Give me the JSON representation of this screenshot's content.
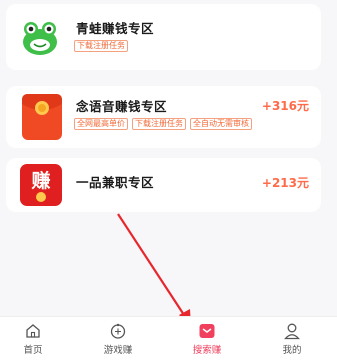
{
  "cards": [
    {
      "title": "青蛙赚钱专区",
      "tags": [
        "下载注册任务"
      ],
      "reward": "",
      "icon": "frog-icon"
    },
    {
      "title": "念语音赚钱专区",
      "tags": [
        "全网最高单价",
        "下载注册任务",
        "全自动无需审核"
      ],
      "reward": "+316元",
      "icon": "red-envelope-icon"
    },
    {
      "title": "一品兼职专区",
      "tags": [],
      "reward": "+213元",
      "icon": "earn-icon",
      "icon_text": "赚"
    }
  ],
  "tabbar": {
    "items": [
      {
        "label": "首页",
        "icon": "home-icon",
        "active": false
      },
      {
        "label": "游戏赚",
        "icon": "game-icon",
        "active": false
      },
      {
        "label": "搜索赚",
        "icon": "search-earn-icon",
        "active": true
      },
      {
        "label": "我的",
        "icon": "profile-icon",
        "active": false
      }
    ]
  },
  "colors": {
    "accent": "#f0405e",
    "reward": "#ff6b4a",
    "tag": "#f06b3a",
    "arrow": "#e8262e"
  }
}
